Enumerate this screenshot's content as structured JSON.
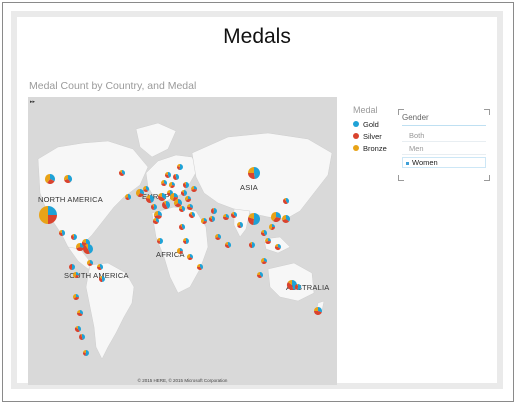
{
  "page": {
    "title": "Medals"
  },
  "visual": {
    "title": "Medal Count by Country, and Medal",
    "copyright": "© 2015 HERE, © 2015 Microsoft Corporation",
    "labels": {
      "north_america": "NORTH AMERICA",
      "south_america": "SOUTH AMERICA",
      "europe": "EUROPE",
      "asia": "ASIA",
      "africa": "AFRICA",
      "australia": "AUSTRALIA"
    }
  },
  "legend": {
    "title": "Medal",
    "items": [
      {
        "label": "Gold",
        "color": "#1fa2d6"
      },
      {
        "label": "Silver",
        "color": "#d9432e"
      },
      {
        "label": "Bronze",
        "color": "#e8a317"
      }
    ]
  },
  "slicer": {
    "header": "Gender",
    "options": [
      {
        "label": "Both",
        "selected": false
      },
      {
        "label": "Men",
        "selected": false
      },
      {
        "label": "Women",
        "selected": true
      }
    ]
  },
  "colors": {
    "land": "#f7f7f7",
    "water": "#d9d9d9",
    "gold": "#1fa2d6",
    "silver": "#d9432e",
    "bronze": "#e8a317"
  }
}
